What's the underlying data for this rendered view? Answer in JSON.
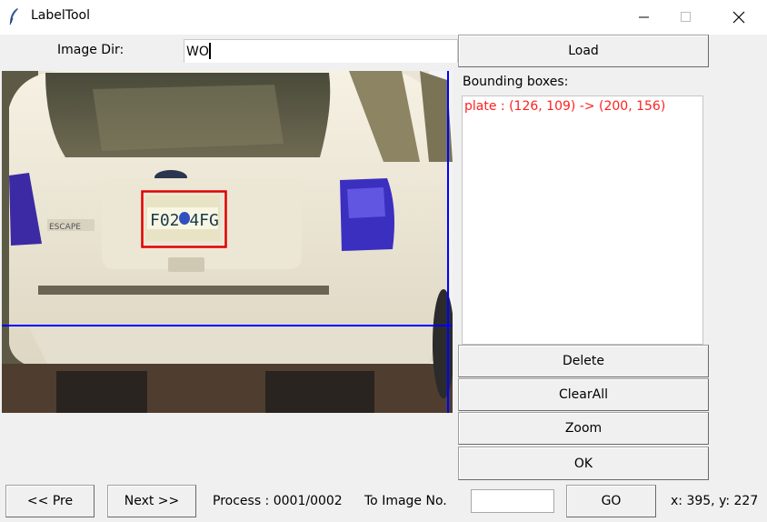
{
  "window": {
    "title": "LabelTool",
    "app_icon": "feather-icon",
    "controls": {
      "minimize": "minimize-icon",
      "maximize": "maximize-icon",
      "close": "close-icon"
    }
  },
  "top": {
    "dir_label": "Image Dir:",
    "dir_value": "WO",
    "load_label": "Load"
  },
  "bbox_panel": {
    "label": "Bounding boxes:",
    "items": [
      "plate : (126, 109) -> (200, 156)"
    ],
    "item_color": "#ff2020"
  },
  "actions": {
    "delete": "Delete",
    "clear_all": "ClearAll",
    "zoom": "Zoom",
    "ok": "OK"
  },
  "bottom": {
    "prev": "<< Pre",
    "next": "Next >>",
    "process": "Process : 0001/0002",
    "to_image": "To Image No.",
    "to_image_value": "",
    "go": "GO",
    "coords": "x: 395, y: 227"
  },
  "canvas": {
    "image_name": "white-suv-rear-photo",
    "box_color": "#e00000",
    "crosshair_color": "#0000ff",
    "plate_text": "F02 4FG",
    "badge_text": "ESCAPE"
  }
}
